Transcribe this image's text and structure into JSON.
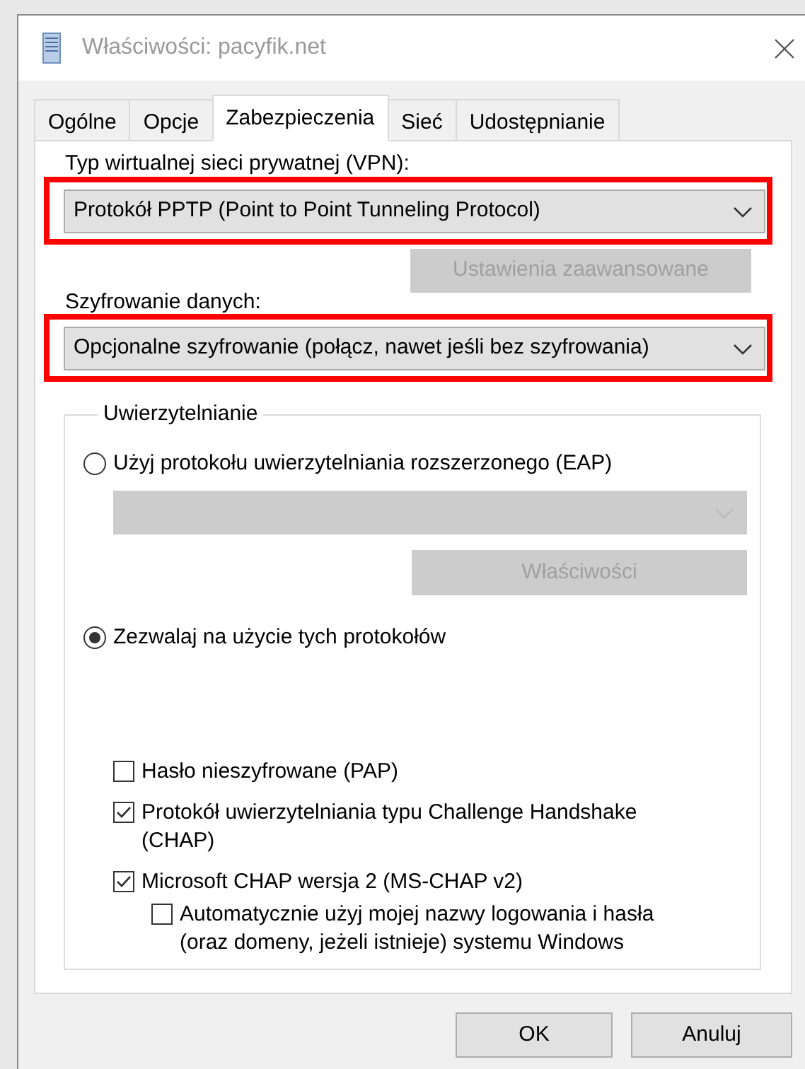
{
  "window": {
    "title": "Właściwości: pacyfik.net"
  },
  "tabs": [
    {
      "label": "Ogólne",
      "selected": false
    },
    {
      "label": "Opcje",
      "selected": false
    },
    {
      "label": "Zabezpieczenia",
      "selected": true
    },
    {
      "label": "Sieć",
      "selected": false
    },
    {
      "label": "Udostępnianie",
      "selected": false
    }
  ],
  "vpn_type": {
    "label": "Typ wirtualnej sieci prywatnej (VPN):",
    "value": "Protokół PPTP (Point to Point Tunneling Protocol)",
    "highlighted": true
  },
  "advanced_button": {
    "label": "Ustawienia zaawansowane",
    "disabled": true
  },
  "encryption": {
    "label": "Szyfrowanie danych:",
    "value": "Opcjonalne szyfrowanie (połącz, nawet jeśli bez szyfrowania)",
    "highlighted": true
  },
  "authentication": {
    "title": "Uwierzytelnianie",
    "eap_radio": {
      "label": "Użyj protokołu uwierzytelniania rozszerzonego (EAP)",
      "selected": false
    },
    "eap_dropdown": {
      "disabled": true
    },
    "properties_button": {
      "label": "Właściwości",
      "disabled": true
    },
    "protocols_radio": {
      "label": "Zezwalaj na użycie tych protokołów",
      "selected": true
    },
    "protocols": [
      {
        "label": "Hasło nieszyfrowane (PAP)",
        "checked": false
      },
      {
        "label": "Protokół uwierzytelniania typu Challenge Handshake (CHAP)",
        "checked": true
      },
      {
        "label": "Microsoft CHAP wersja 2 (MS-CHAP v2)",
        "checked": true,
        "children": [
          {
            "label": "Automatycznie użyj mojej nazwy logowania i hasła (oraz domeny, jeżeli istnieje) systemu Windows",
            "checked": false
          }
        ]
      }
    ]
  },
  "buttons": [
    {
      "label": "OK"
    },
    {
      "label": "Anuluj"
    }
  ]
}
